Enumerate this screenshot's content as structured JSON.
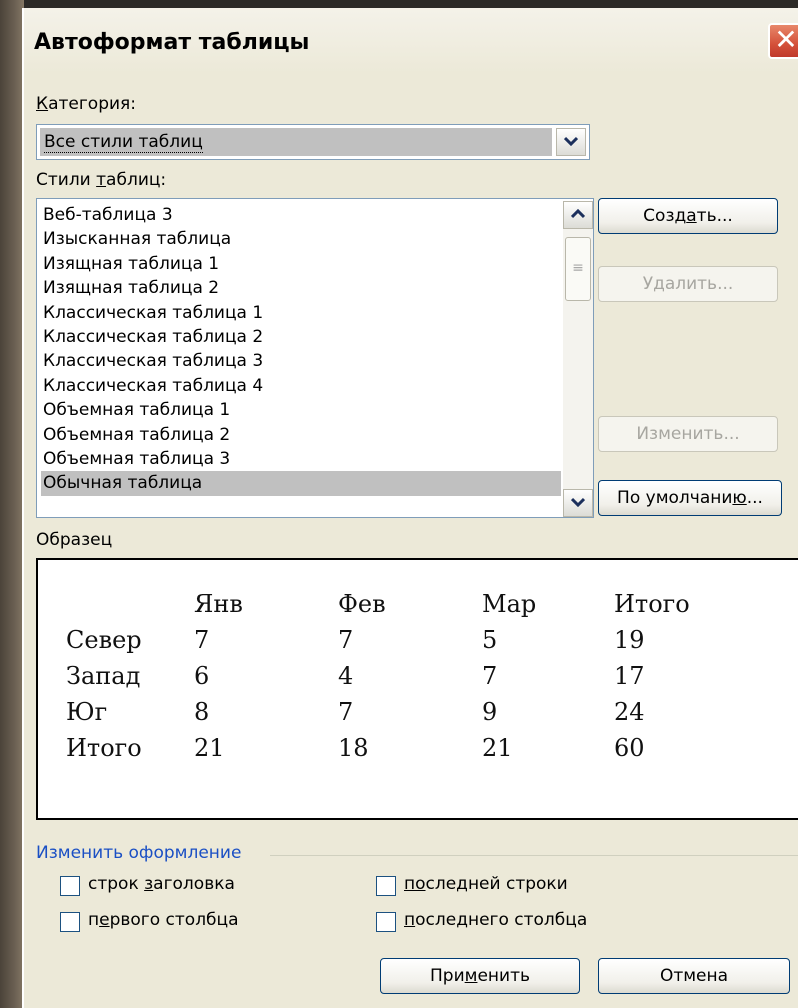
{
  "dialog": {
    "title": "Автоформат таблицы",
    "close_glyph": "✕"
  },
  "category": {
    "label_prefix": "",
    "label_hotkey": "К",
    "label_rest": "атегория:",
    "value": "Все стили таблиц"
  },
  "styles": {
    "label_prefix": "Стили ",
    "label_hotkey": "т",
    "label_rest": "аблиц:",
    "items": [
      "Веб-таблица 3",
      "Изысканная таблица",
      "Изящная таблица 1",
      "Изящная таблица 2",
      "Классическая таблица 1",
      "Классическая таблица 2",
      "Классическая таблица 3",
      "Классическая таблица 4",
      "Объемная таблица 1",
      "Объемная таблица 2",
      "Объемная таблица 3",
      "Обычная таблица"
    ],
    "selected": "Обычная таблица"
  },
  "buttons": {
    "create": {
      "prefix": "Созд",
      "hotkey": "а",
      "rest": "ть..."
    },
    "delete": "Удалить...",
    "modify": "Изменить...",
    "default": {
      "prefix": "По умолчани",
      "hotkey": "ю",
      "rest": "..."
    },
    "apply": {
      "prefix": "При",
      "hotkey": "м",
      "rest": "енить"
    },
    "cancel": "Отмена"
  },
  "sample": {
    "label": "Образец",
    "header": [
      "",
      "Янв",
      "Фев",
      "Мар",
      "Итого"
    ],
    "rows": [
      [
        "Север",
        "7",
        "7",
        "5",
        "19"
      ],
      [
        "Запад",
        "6",
        "4",
        "7",
        "17"
      ],
      [
        "Юг",
        "8",
        "7",
        "9",
        "24"
      ],
      [
        "Итого",
        "21",
        "18",
        "21",
        "60"
      ]
    ]
  },
  "format_group": {
    "label": "Изменить оформление",
    "options": [
      {
        "prefix": "строк ",
        "hotkey": "з",
        "rest": "аголовка",
        "checked": false
      },
      {
        "prefix": "",
        "hotkey": "по",
        "rest": "следней строки",
        "checked": false
      },
      {
        "prefix": "п",
        "hotkey": "е",
        "rest": "рвого столбца",
        "checked": false
      },
      {
        "prefix": "",
        "hotkey": "п",
        "rest": "оследнего столбца",
        "checked": false
      }
    ]
  },
  "icons": {
    "dropdown": "chevron-down-icon",
    "scroll_up": "chevron-up-icon",
    "scroll_down": "chevron-down-icon",
    "close": "close-icon"
  }
}
